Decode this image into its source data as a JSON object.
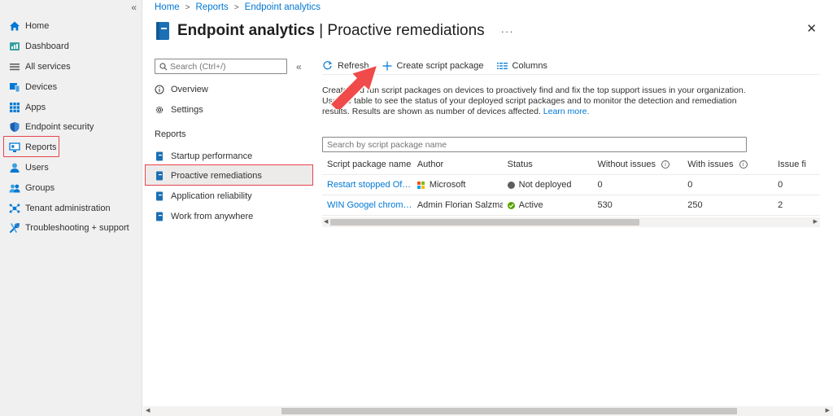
{
  "leftnav": {
    "items": [
      {
        "label": "Home",
        "icon": "home-icon"
      },
      {
        "label": "Dashboard",
        "icon": "dashboard-icon"
      },
      {
        "label": "All services",
        "icon": "all-services-icon"
      },
      {
        "label": "Devices",
        "icon": "devices-icon"
      },
      {
        "label": "Apps",
        "icon": "apps-icon"
      },
      {
        "label": "Endpoint security",
        "icon": "shield-icon"
      },
      {
        "label": "Reports",
        "icon": "reports-icon"
      },
      {
        "label": "Users",
        "icon": "user-icon"
      },
      {
        "label": "Groups",
        "icon": "groups-icon"
      },
      {
        "label": "Tenant administration",
        "icon": "tenant-admin-icon"
      },
      {
        "label": "Troubleshooting + support",
        "icon": "wrench-icon"
      }
    ],
    "collapse_glyph": "«"
  },
  "breadcrumb": [
    "Home",
    "Reports",
    "Endpoint analytics"
  ],
  "header": {
    "title_bold": "Endpoint analytics",
    "title_rest": " | Proactive remediations",
    "more": "···",
    "close": "✕"
  },
  "subnav": {
    "search_placeholder": "Search (Ctrl+/)",
    "collapse_glyph": "«",
    "items_top": [
      "Overview",
      "Settings"
    ],
    "section": "Reports",
    "items_reports": [
      "Startup performance",
      "Proactive remediations",
      "Application reliability",
      "Work from anywhere"
    ]
  },
  "toolbar": {
    "refresh": "Refresh",
    "create": "Create script package",
    "columns": "Columns"
  },
  "description": {
    "text": "Create and run script packages on devices to proactively find and fix the top support issues in your organization. Use the table to see the status of your deployed script packages and to monitor the detection and remediation results. Results are shown as number of devices affected.",
    "link": "Learn more."
  },
  "filter": {
    "placeholder": "Search by script package name"
  },
  "table": {
    "columns": [
      "Script package name",
      "Author",
      "Status",
      "Without issues",
      "With issues",
      "Issue fi"
    ],
    "rows": [
      {
        "name": "Restart stopped Office…",
        "author": "Microsoft",
        "status": "Not deployed",
        "without": "0",
        "with": "0",
        "fixed": "0"
      },
      {
        "name": "WIN Googel chrome …",
        "author": "Admin Florian Salzmann",
        "status": "Active",
        "without": "530",
        "with": "250",
        "fixed": "2"
      }
    ]
  },
  "colors": {
    "accent": "#0078d4",
    "highlight": "#e8434d",
    "status_not_deployed": "#605e5c",
    "status_active": "#57a300"
  }
}
